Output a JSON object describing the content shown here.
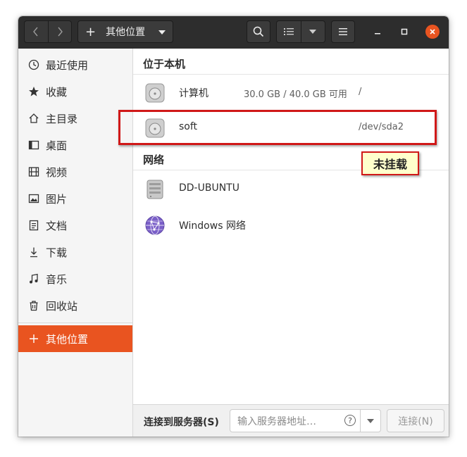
{
  "headerbar": {
    "back_icon": "chevron-left-icon",
    "forward_icon": "chevron-right-icon",
    "location_label": "其他位置",
    "search_icon": "search-icon",
    "view_icon": "list-view-icon",
    "menu_icon": "hamburger-menu-icon",
    "minimize": "minimize-icon",
    "maximize": "maximize-icon",
    "close": "close-icon"
  },
  "sidebar": {
    "items": [
      {
        "label": "最近使用",
        "icon": "clock-icon"
      },
      {
        "label": "收藏",
        "icon": "star-icon"
      },
      {
        "label": "主目录",
        "icon": "home-icon"
      },
      {
        "label": "桌面",
        "icon": "desktop-icon"
      },
      {
        "label": "视频",
        "icon": "video-icon"
      },
      {
        "label": "图片",
        "icon": "picture-icon"
      },
      {
        "label": "文档",
        "icon": "document-icon"
      },
      {
        "label": "下载",
        "icon": "download-icon"
      },
      {
        "label": "音乐",
        "icon": "music-icon"
      },
      {
        "label": "回收站",
        "icon": "trash-icon"
      }
    ],
    "other_locations": {
      "label": "其他位置",
      "icon": "plus-icon"
    }
  },
  "main": {
    "this_computer": {
      "heading": "位于本机",
      "rows": [
        {
          "name": "计算机",
          "size": "30.0 GB / 40.0 GB 可用",
          "mount": "/"
        },
        {
          "name": "soft",
          "size": "",
          "mount": "/dev/sda2"
        }
      ]
    },
    "network": {
      "heading": "网络",
      "rows": [
        {
          "name": "DD-UBUNTU"
        },
        {
          "name": "Windows 网络"
        }
      ]
    },
    "callout": "未挂载"
  },
  "bottombar": {
    "label": "连接到服务器(S)",
    "placeholder": "输入服务器地址…",
    "help": "?",
    "connect": "连接(N)"
  },
  "colors": {
    "accent": "#e95420",
    "headerbar": "#2d2d2d",
    "annotation_red": "#d01818",
    "callout_bg": "#ffffcc"
  }
}
